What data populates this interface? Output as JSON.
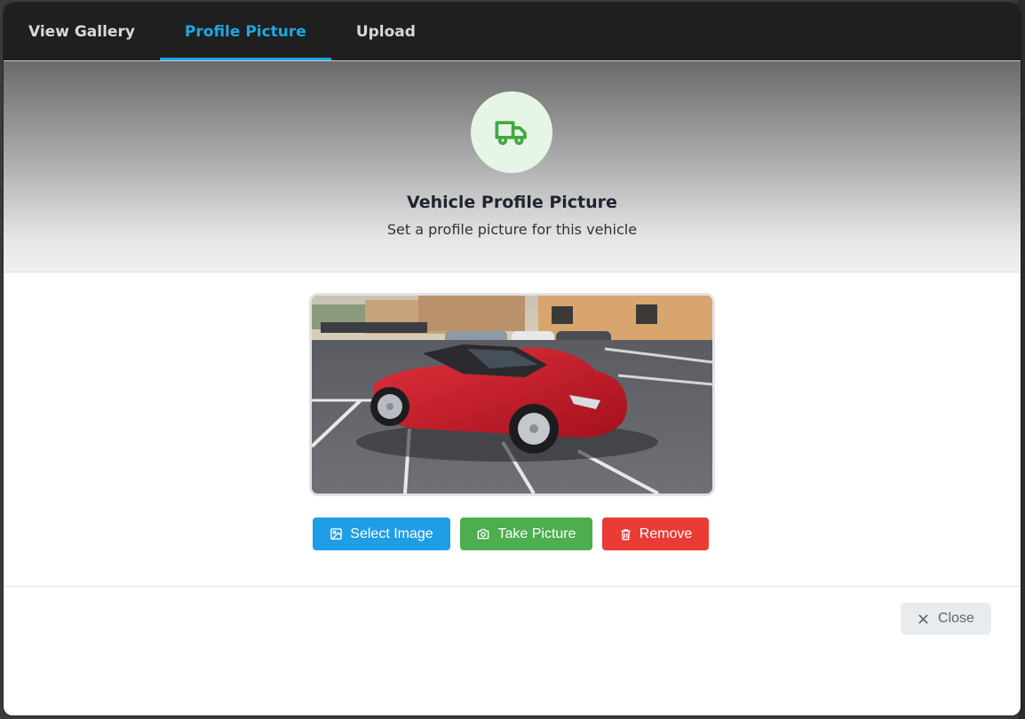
{
  "tabs": [
    {
      "label": "View Gallery",
      "active": false
    },
    {
      "label": "Profile Picture",
      "active": true
    },
    {
      "label": "Upload",
      "active": false
    }
  ],
  "header": {
    "icon": "truck-icon",
    "title": "Vehicle Profile Picture",
    "subtitle": "Set a profile picture for this vehicle"
  },
  "photo": {
    "description_icon": "vehicle-photo"
  },
  "actions": {
    "select_label": "Select Image",
    "take_label": "Take Picture",
    "remove_label": "Remove"
  },
  "footer": {
    "close_label": "Close"
  },
  "colors": {
    "accent": "#1ea7e1",
    "select": "#1f9ee6",
    "take": "#4cae4f",
    "remove": "#ea3b35",
    "icon_green": "#43a843"
  }
}
